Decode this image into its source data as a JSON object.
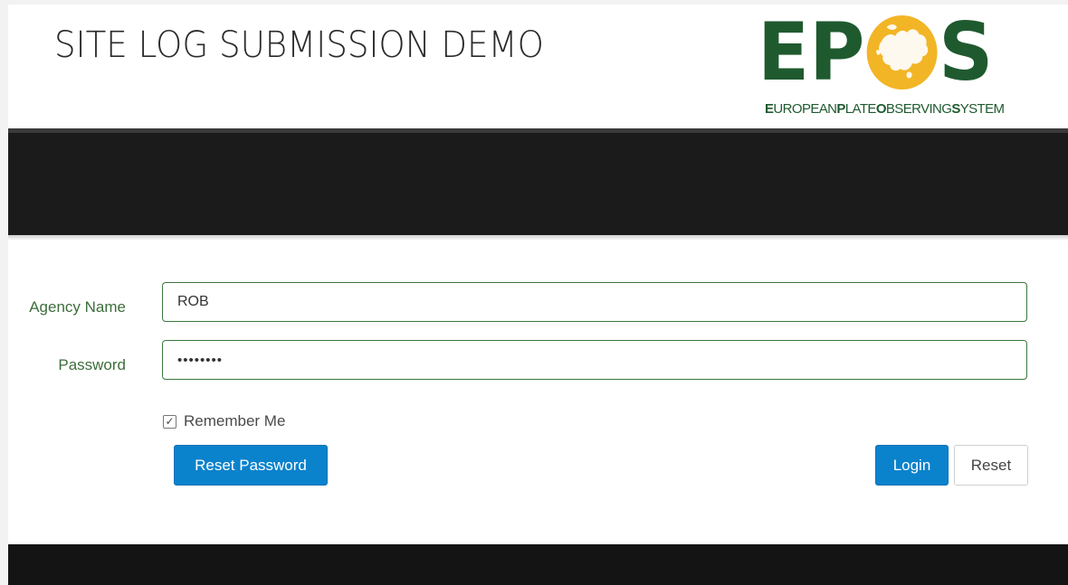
{
  "header": {
    "title": "SITE LOG SUBMISSION DEMO",
    "logo": {
      "letters": [
        "E",
        "P",
        "S"
      ],
      "subtitle_parts": [
        {
          "text": "E",
          "bold": true
        },
        {
          "text": "UROPEAN",
          "bold": false
        },
        {
          "text": "P",
          "bold": true
        },
        {
          "text": "LATE",
          "bold": false
        },
        {
          "text": "O",
          "bold": true
        },
        {
          "text": "BSERVING",
          "bold": false
        },
        {
          "text": "S",
          "bold": true
        },
        {
          "text": "YSTEM",
          "bold": false
        }
      ],
      "icon": "europe-globe-icon"
    }
  },
  "form": {
    "agency_label": "Agency Name",
    "agency_value": "ROB",
    "password_label": "Password",
    "password_value": "••••••••",
    "remember_label": "Remember Me",
    "remember_checked": true,
    "reset_password_label": "Reset Password",
    "login_label": "Login",
    "reset_label": "Reset"
  },
  "colors": {
    "brand_green": "#1f5a2f",
    "brand_gold": "#f2b526",
    "primary_button": "#0a82cc",
    "label_green": "#3c6e3c",
    "dark_band": "#1b1b1b"
  }
}
